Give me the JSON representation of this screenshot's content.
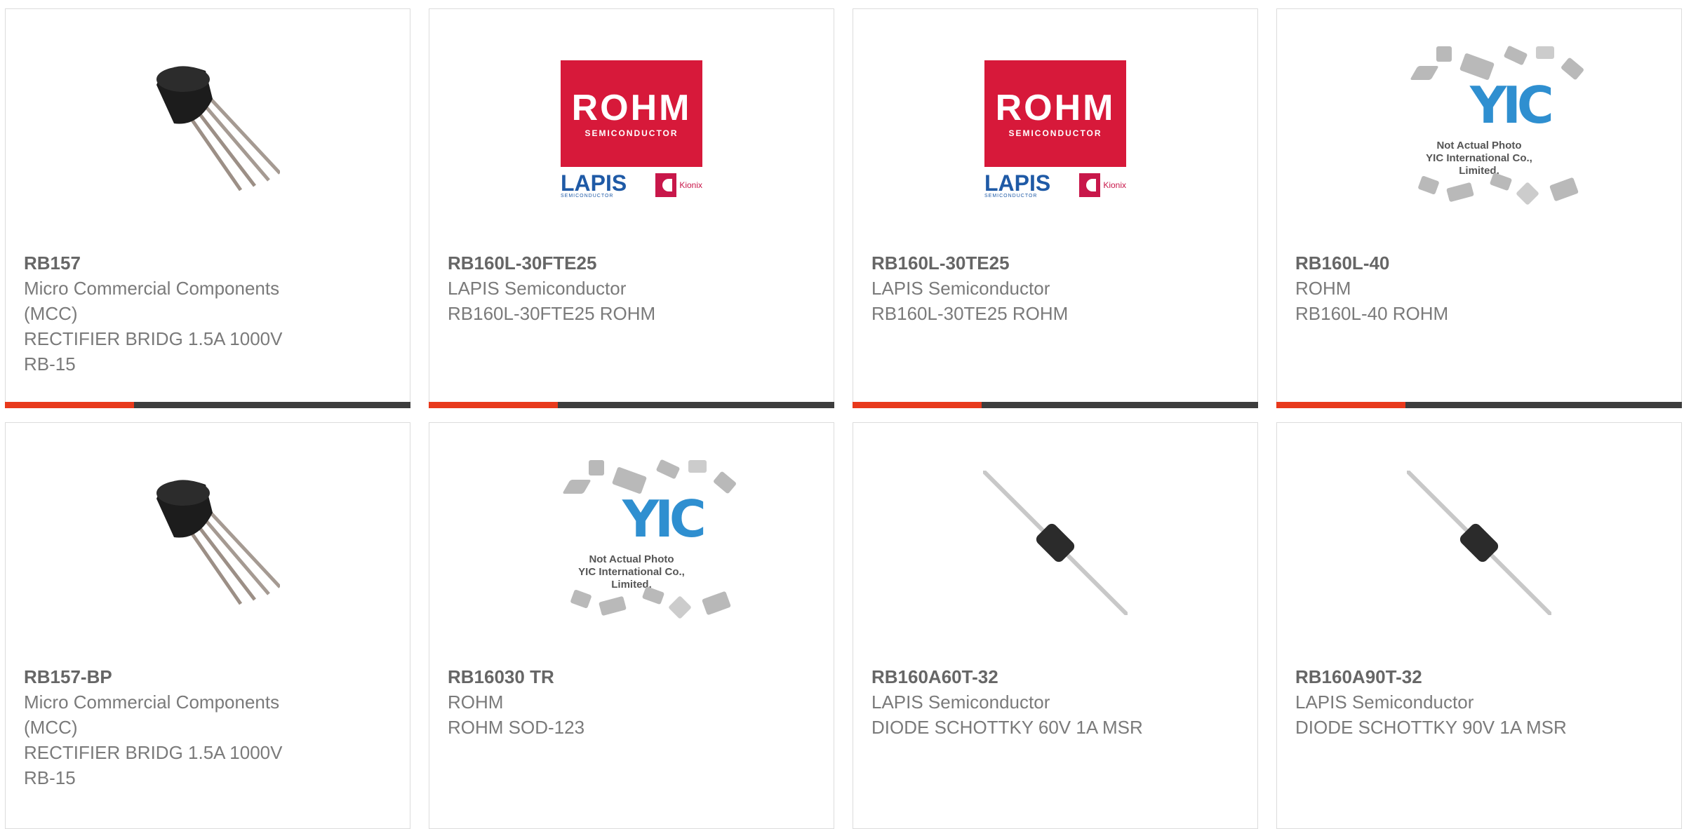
{
  "products": [
    {
      "part": "RB157",
      "lines": [
        "Micro Commercial Components",
        "(MCC)",
        "RECTIFIER BRIDG 1.5A 1000V",
        "RB-15"
      ],
      "image": "bridge-rectifier-icon"
    },
    {
      "part": "RB160L-30FTE25",
      "lines": [
        "LAPIS Semiconductor",
        "RB160L-30FTE25 ROHM"
      ],
      "image": "rohm-lapis-kionix-logo",
      "logo": {
        "brand": "ROHM",
        "sub": "SEMICONDUCTOR",
        "lapis": "LAPIS",
        "lapis_sub": "SEMICONDUCTOR",
        "kionix": "Kionix"
      }
    },
    {
      "part": "RB160L-30TE25",
      "lines": [
        "LAPIS Semiconductor",
        "RB160L-30TE25 ROHM"
      ],
      "image": "rohm-lapis-kionix-logo",
      "logo": {
        "brand": "ROHM",
        "sub": "SEMICONDUCTOR",
        "lapis": "LAPIS",
        "lapis_sub": "SEMICONDUCTOR",
        "kionix": "Kionix"
      }
    },
    {
      "part": "RB160L-40",
      "lines": [
        "ROHM",
        "RB160L-40 ROHM"
      ],
      "image": "yic-not-actual-photo",
      "placeholder": {
        "mark": "YIC",
        "line1": "Not Actual Photo",
        "line2": "YIC International Co., Limited."
      }
    },
    {
      "part": "RB157-BP",
      "lines": [
        "Micro Commercial Components",
        "(MCC)",
        "RECTIFIER BRIDG 1.5A 1000V",
        "RB-15"
      ],
      "image": "bridge-rectifier-icon"
    },
    {
      "part": "RB16030 TR",
      "lines": [
        "ROHM",
        "ROHM SOD-123"
      ],
      "image": "yic-not-actual-photo",
      "placeholder": {
        "mark": "YIC",
        "line1": "Not Actual Photo",
        "line2": "YIC International Co., Limited."
      }
    },
    {
      "part": "RB160A60T-32",
      "lines": [
        "LAPIS Semiconductor",
        "DIODE SCHOTTKY 60V 1A MSR"
      ],
      "image": "axial-diode-icon"
    },
    {
      "part": "RB160A90T-32",
      "lines": [
        "LAPIS Semiconductor",
        "DIODE SCHOTTKY 90V 1A MSR"
      ],
      "image": "axial-diode-icon"
    }
  ],
  "colors": {
    "accent": "#e8391c",
    "bar": "#3d3d3d",
    "rohm_red": "#d7193a",
    "lapis_blue": "#1f5aa6",
    "yic_blue": "#2f8fd0"
  }
}
